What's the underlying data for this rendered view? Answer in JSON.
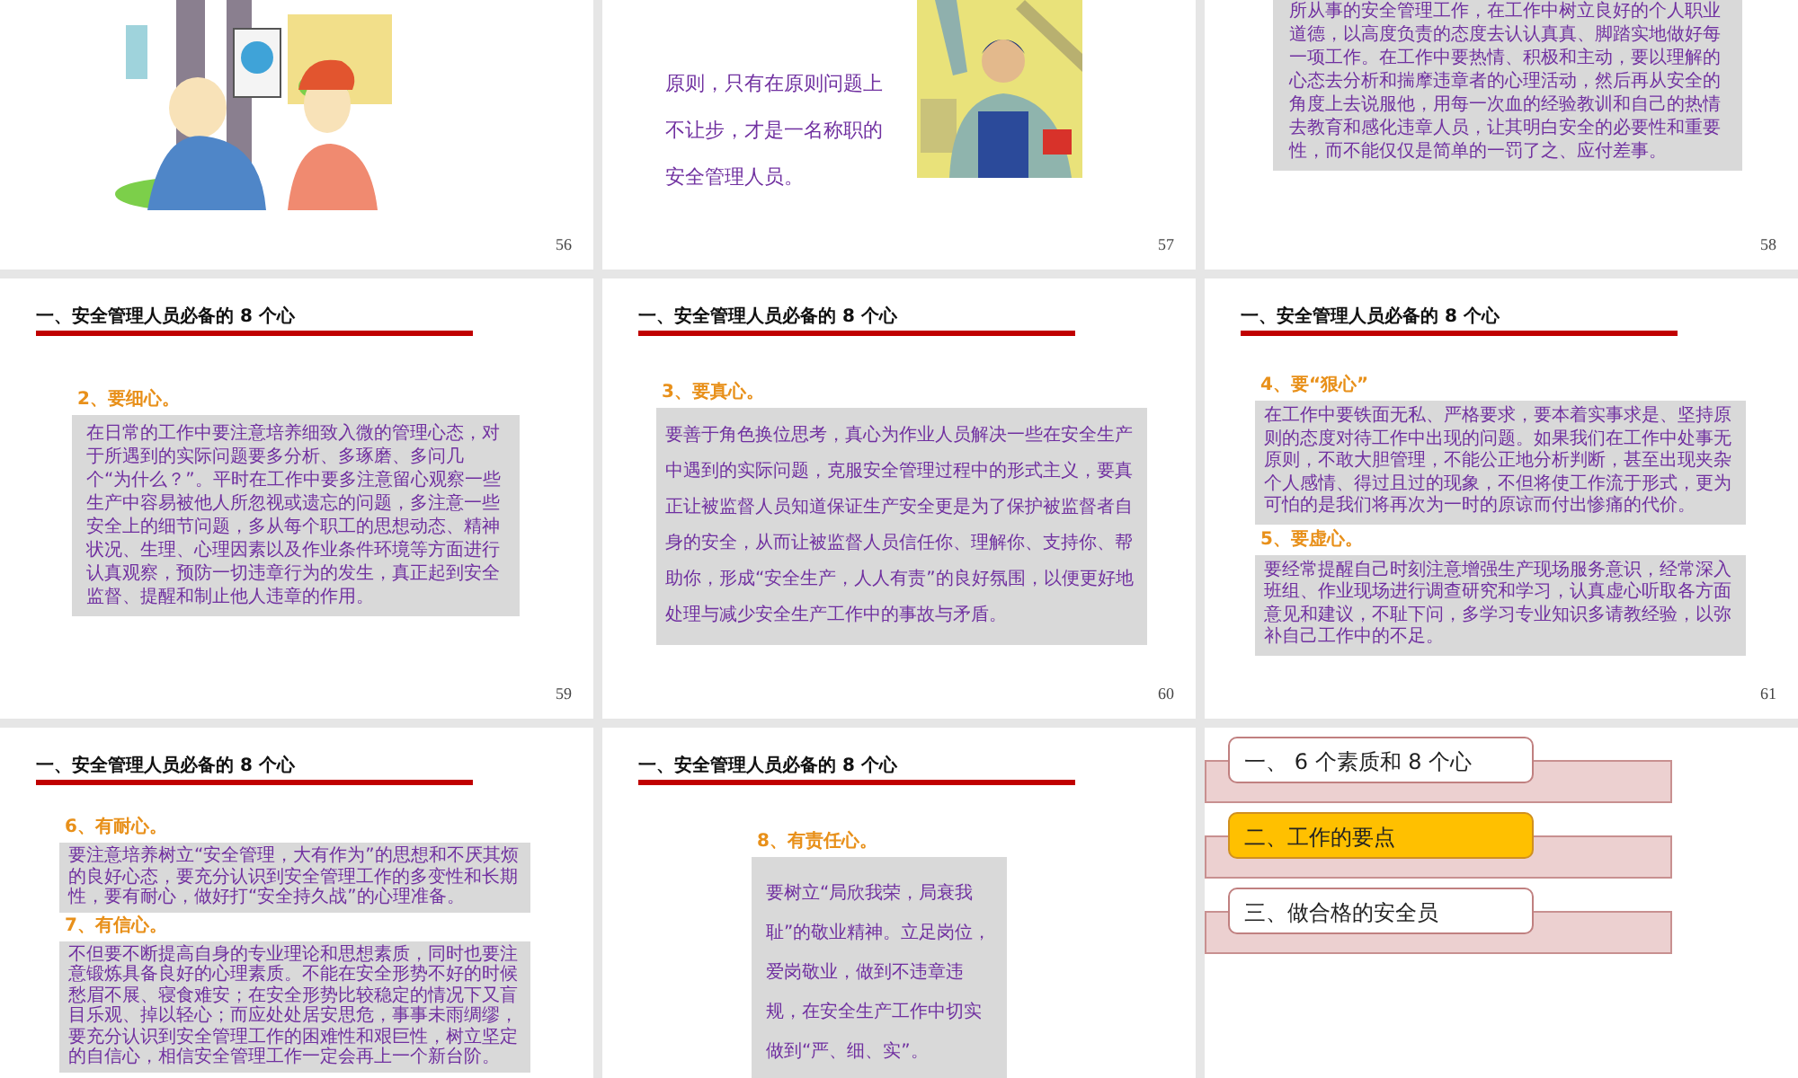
{
  "slides": [
    {
      "kind": "picture",
      "number": "56"
    },
    {
      "kind": "text_picture",
      "number": "57",
      "text": "原则，只有在原则问题上不让步，才是一名称职的安全管理人员。"
    },
    {
      "kind": "boxed",
      "number": "58",
      "sections": [
        {
          "body": "所从事的安全管理工作，在工作中树立良好的个人职业道德，以高度负责的态度去认认真真、脚踏实地做好每一项工作。在工作中要热情、积极和主动，要以理解的心态去分析和揣摩违章者的心理活动，然后再从安全的角度上去说服他，用每一次血的经验教训和自己的热情去教育和感化违章人员，让其明白安全的必要性和重要性，而不能仅仅是简单的一罚了之、应付差事。"
        }
      ]
    },
    {
      "kind": "boxed",
      "number": "59",
      "title": "一、安全管理人员必备的 8 个心",
      "sections": [
        {
          "heading": "2、要细心。",
          "body": "在日常的工作中要注意培养细致入微的管理心态，对于所遇到的实际问题要多分析、多琢磨、多问几个“为什么？”。平时在工作中要多注意留心观察一些生产中容易被他人所忽视或遗忘的问题，多注意一些安全上的细节问题，多从每个职工的思想动态、精神状况、生理、心理因素以及作业条件环境等方面进行认真观察，预防一切违章行为的发生，真正起到安全监督、提醒和制止他人违章的作用。"
        }
      ]
    },
    {
      "kind": "boxed",
      "number": "60",
      "title": "一、安全管理人员必备的 8 个心",
      "sections": [
        {
          "heading": "3、要真心。",
          "body": "要善于角色换位思考，真心为作业人员解决一些在安全生产中遇到的实际问题，克服安全管理过程中的形式主义，要真正让被监督人员知道保证生产安全更是为了保护被监督者自身的安全，从而让被监督人员信任你、理解你、支持你、帮助你，形成“安全生产，人人有责”的良好氛围，以便更好地处理与减少安全生产工作中的事故与矛盾。"
        }
      ]
    },
    {
      "kind": "boxed",
      "number": "61",
      "title": "一、安全管理人员必备的 8 个心",
      "sections": [
        {
          "heading": "4、要“狠心”",
          "body": "在工作中要铁面无私、严格要求，要本着实事求是、坚持原则的态度对待工作中出现的问题。如果我们在工作中处事无原则，不敢大胆管理，不能公正地分析判断，甚至出现夹杂个人感情、得过且过的现象，不但将使工作流于形式，更为可怕的是我们将再次为一时的原谅而付出惨痛的代价。"
        },
        {
          "heading": "5、要虚心。",
          "body": "要经常提醒自己时刻注意增强生产现场服务意识，经常深入班组、作业现场进行调查研究和学习，认真虚心听取各方面意见和建议，不耻下问，多学习专业知识多请教经验，以弥补自己工作中的不足。"
        }
      ]
    },
    {
      "kind": "boxed",
      "title": "一、安全管理人员必备的 8 个心",
      "sections": [
        {
          "heading": "6、有耐心。",
          "body": "要注意培养树立“安全管理，大有作为”的思想和不厌其烦的良好心态，要充分认识到安全管理工作的多变性和长期性，要有耐心，做好打“安全持久战”的心理准备。"
        },
        {
          "heading": "7、有信心。",
          "body": "不但要不断提高自身的专业理论和思想素质，同时也要注意锻炼具备良好的心理素质。不能在安全形势不好的时候愁眉不展、寝食难安；在安全形势比较稳定的情况下又盲目乐观、掉以轻心；而应处处居安思危，事事未雨绸缪，要充分认识到安全管理工作的困难性和艰巨性，树立坚定的自信心，相信安全管理工作一定会再上一个新台阶。"
        }
      ]
    },
    {
      "kind": "boxed",
      "title": "一、安全管理人员必备的 8 个心",
      "sections": [
        {
          "heading": "8、有责任心。",
          "body": "要树立“局欣我荣，局衰我耻”的敬业精神。立足岗位，爱岗敬业，做到不违章违规，在安全生产工作中切实做到“严、细、实”。"
        }
      ]
    },
    {
      "kind": "menu",
      "items": [
        {
          "label": "一、 6 个素质和 8 个心",
          "selected": false
        },
        {
          "label": "二、工作的要点",
          "selected": true
        },
        {
          "label": "三、做合格的安全员",
          "selected": false
        }
      ]
    }
  ]
}
